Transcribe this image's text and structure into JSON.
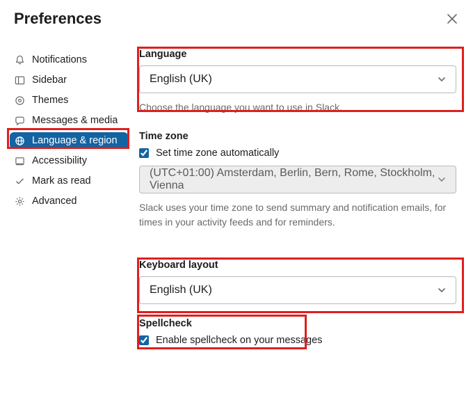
{
  "header": {
    "title": "Preferences"
  },
  "sidebar": {
    "items": [
      {
        "label": "Notifications"
      },
      {
        "label": "Sidebar"
      },
      {
        "label": "Themes"
      },
      {
        "label": "Messages & media"
      },
      {
        "label": "Language & region"
      },
      {
        "label": "Accessibility"
      },
      {
        "label": "Mark as read"
      },
      {
        "label": "Advanced"
      }
    ],
    "active_index": 4
  },
  "language": {
    "title": "Language",
    "value": "English (UK)",
    "helper": "Choose the language you want to use in Slack."
  },
  "timezone": {
    "title": "Time zone",
    "auto_label": "Set time zone automatically",
    "auto_checked": true,
    "value": "(UTC+01:00) Amsterdam, Berlin, Bern, Rome, Stockholm, Vienna",
    "helper": "Slack uses your time zone to send summary and notification emails, for times in your activity feeds and for reminders."
  },
  "keyboard": {
    "title": "Keyboard layout",
    "value": "English (UK)"
  },
  "spellcheck": {
    "title": "Spellcheck",
    "label": "Enable spellcheck on your messages",
    "checked": true
  }
}
